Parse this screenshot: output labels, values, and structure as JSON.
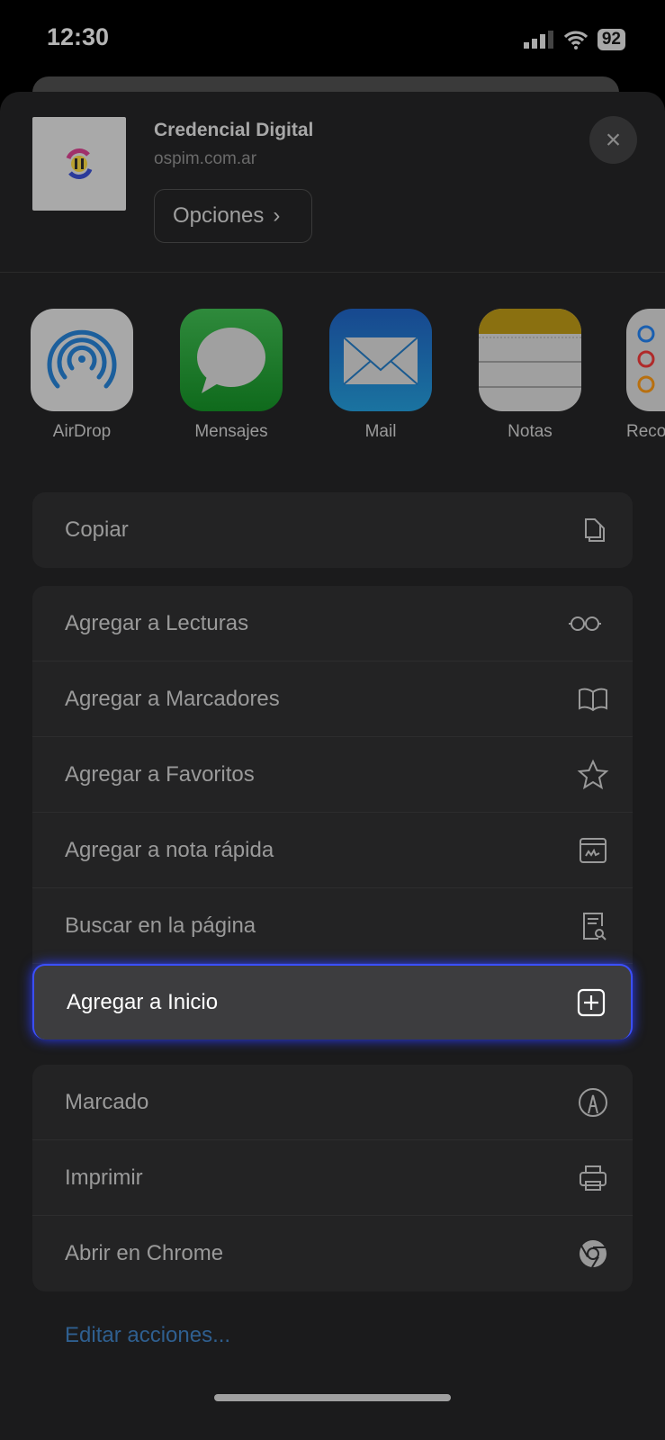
{
  "status": {
    "time": "12:30",
    "battery": "92"
  },
  "header": {
    "title": "Credencial Digital",
    "url": "ospim.com.ar",
    "options_label": "Opciones",
    "options_chevron": "›",
    "close_icon": "×"
  },
  "apps": [
    {
      "label": "AirDrop",
      "icon": "airdrop-icon"
    },
    {
      "label": "Mensajes",
      "icon": "messages-icon"
    },
    {
      "label": "Mail",
      "icon": "mail-icon"
    },
    {
      "label": "Notas",
      "icon": "notes-icon"
    },
    {
      "label": "Reco",
      "icon": "reminders-icon"
    }
  ],
  "groups": [
    [
      {
        "label": "Copiar",
        "icon": "copy-icon"
      }
    ],
    [
      {
        "label": "Agregar a Lecturas",
        "icon": "glasses-icon"
      },
      {
        "label": "Agregar a Marcadores",
        "icon": "book-icon"
      },
      {
        "label": "Agregar a Favoritos",
        "icon": "star-icon"
      },
      {
        "label": "Agregar a nota rápida",
        "icon": "quick-note-icon"
      },
      {
        "label": "Buscar en la página",
        "icon": "find-in-page-icon"
      },
      {
        "label": "Agregar a Inicio",
        "icon": "add-square-icon",
        "highlighted": true
      }
    ],
    [
      {
        "label": "Marcado",
        "icon": "markup-icon"
      },
      {
        "label": "Imprimir",
        "icon": "printer-icon"
      },
      {
        "label": "Abrir en Chrome",
        "icon": "chrome-icon"
      }
    ]
  ],
  "edit_actions": "Editar acciones...",
  "colors": {
    "highlight_border": "#3b4fff",
    "link": "#2f5f8f"
  }
}
